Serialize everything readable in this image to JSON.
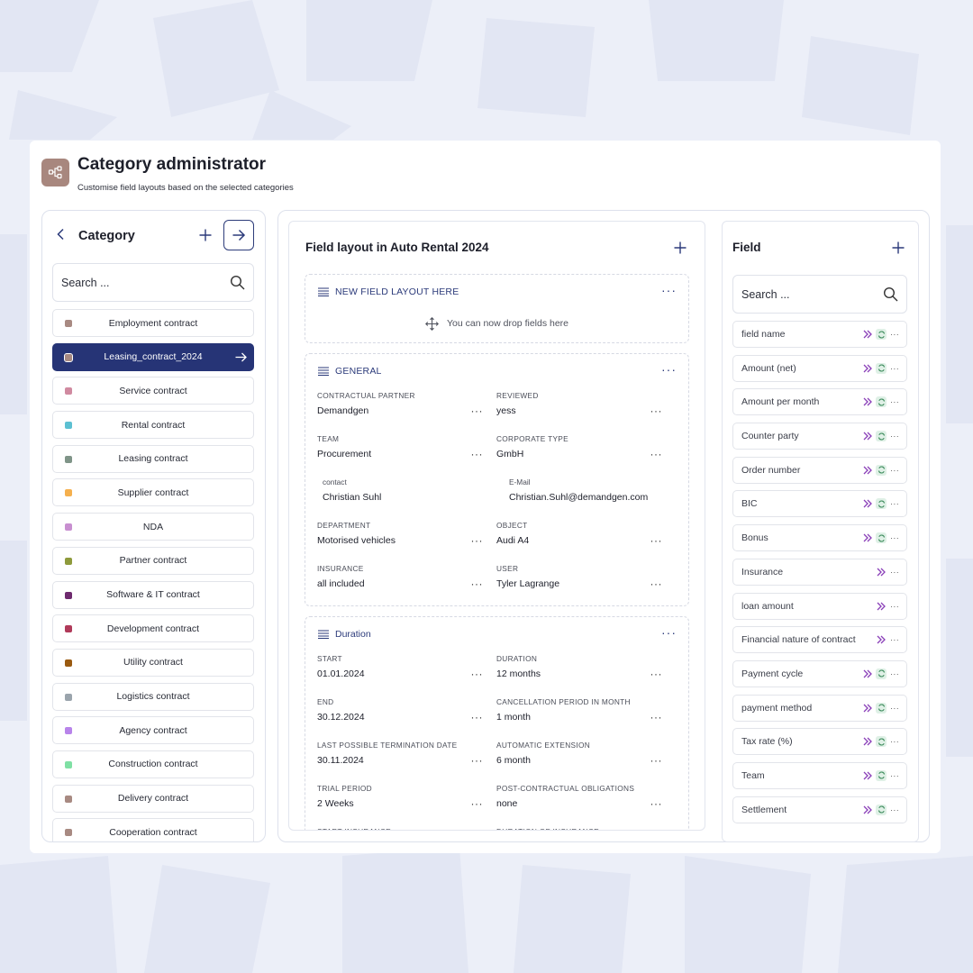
{
  "header": {
    "title": "Category administrator",
    "subtitle": "Customise field layouts based on the selected categories"
  },
  "category_panel": {
    "title": "Category",
    "search_placeholder": "Search ...",
    "items": [
      {
        "label": "Employment contract",
        "color": "#a88a82",
        "active": false
      },
      {
        "label": "Leasing_contract_2024",
        "color": "#a88a82",
        "active": true
      },
      {
        "label": "Service contract",
        "color": "#d08aa0",
        "active": false
      },
      {
        "label": "Rental contract",
        "color": "#5cc0d2",
        "active": false
      },
      {
        "label": "Leasing contract",
        "color": "#7f9488",
        "active": false
      },
      {
        "label": "Supplier contract",
        "color": "#f5b04e",
        "active": false
      },
      {
        "label": "NDA",
        "color": "#c88fd0",
        "active": false
      },
      {
        "label": "Partner contract",
        "color": "#8e9a3c",
        "active": false
      },
      {
        "label": "Software & IT contract",
        "color": "#6e2a6e",
        "active": false
      },
      {
        "label": "Development contract",
        "color": "#b03a5a",
        "active": false
      },
      {
        "label": "Utility contract",
        "color": "#9a5a10",
        "active": false
      },
      {
        "label": "Logistics contract",
        "color": "#9aa4ac",
        "active": false
      },
      {
        "label": "Agency contract",
        "color": "#b884ea",
        "active": false
      },
      {
        "label": "Construction contract",
        "color": "#7fe0a4",
        "active": false
      },
      {
        "label": "Delivery contract",
        "color": "#a88a82",
        "active": false
      },
      {
        "label": "Cooperation contract",
        "color": "#a88a82",
        "active": false
      }
    ]
  },
  "layout_panel": {
    "title": "Field layout in Auto Rental 2024",
    "new_section": {
      "name": "NEW FIELD LAYOUT HERE",
      "drop_hint": "You can now drop fields here"
    },
    "general": {
      "name": "GENERAL",
      "fields": [
        {
          "label": "CONTRACTUAL PARTNER",
          "value": "Demandgen"
        },
        {
          "label": "REVIEWED",
          "value": "yess"
        },
        {
          "label": "TEAM",
          "value": "Procurement"
        },
        {
          "label": "CORPORATE TYPE",
          "value": "GmbH"
        },
        {
          "label": "contact",
          "value": "Christian Suhl"
        },
        {
          "label": "E-Mail",
          "value": "Christian.Suhl@demandgen.com"
        },
        {
          "label": "DEPARTMENT",
          "value": "Motorised vehicles"
        },
        {
          "label": "OBJECT",
          "value": "Audi A4"
        },
        {
          "label": "INSURANCE",
          "value": "all included"
        },
        {
          "label": "USER",
          "value": "Tyler Lagrange"
        }
      ]
    },
    "duration": {
      "name": "Duration",
      "fields": [
        {
          "label": "START",
          "value": "01.01.2024"
        },
        {
          "label": "DURATION",
          "value": "12 months"
        },
        {
          "label": "END",
          "value": "30.12.2024"
        },
        {
          "label": "CANCELLATION PERIOD IN MONTH",
          "value": "1 month"
        },
        {
          "label": "LAST POSSIBLE TERMINATION DATE",
          "value": "30.11.2024"
        },
        {
          "label": "AUTOMATIC EXTENSION",
          "value": "6 month"
        },
        {
          "label": "TRIAL PERIOD",
          "value": "2 Weeks"
        },
        {
          "label": "POST-CONTRACTUAL OBLIGATIONS",
          "value": "none"
        },
        {
          "label": "START INSURANCE",
          "value": ""
        },
        {
          "label": "DURATION OF INSURANCE",
          "value": ""
        }
      ]
    }
  },
  "field_panel": {
    "title": "Field",
    "search_placeholder": "Search ...",
    "items": [
      {
        "name": "field name",
        "sync": true
      },
      {
        "name": "Amount (net)",
        "sync": true
      },
      {
        "name": "Amount per month",
        "sync": true
      },
      {
        "name": "Counter party",
        "sync": true
      },
      {
        "name": "Order number",
        "sync": true
      },
      {
        "name": "BIC",
        "sync": true
      },
      {
        "name": "Bonus",
        "sync": true
      },
      {
        "name": "Insurance",
        "sync": false
      },
      {
        "name": "loan amount",
        "sync": false
      },
      {
        "name": "Financial nature of contract",
        "sync": false
      },
      {
        "name": "Payment cycle",
        "sync": true
      },
      {
        "name": "payment method",
        "sync": true
      },
      {
        "name": "Tax rate (%)",
        "sync": true
      },
      {
        "name": "Team",
        "sync": true
      },
      {
        "name": "Settlement",
        "sync": true
      }
    ]
  },
  "colors": {
    "accent": "#263476",
    "background": "#eceff8",
    "logo_bg": "#a8877e"
  }
}
